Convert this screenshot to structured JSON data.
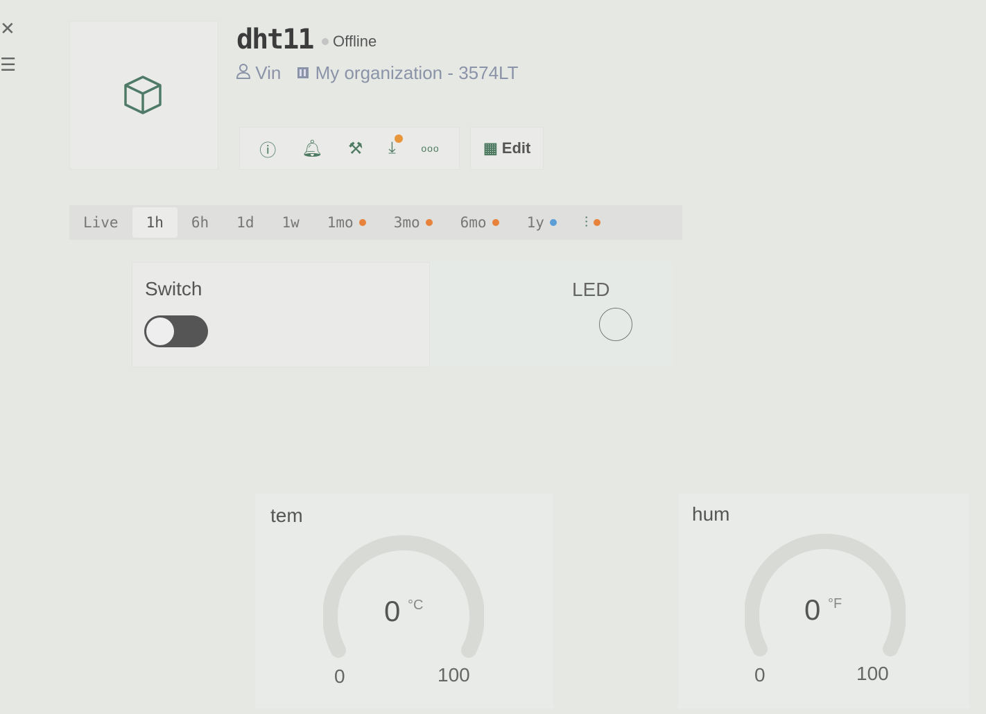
{
  "sidebar": {
    "close_icon": "close-icon",
    "menu_icon": "hamburger-menu-icon"
  },
  "device": {
    "name": "dht11",
    "status": "Offline",
    "status_color": "#c4c4c4",
    "owner": "Vin",
    "organization": "My organization - 3574LT",
    "icon": "cube-icon"
  },
  "toolbar": {
    "icons": [
      "info-icon",
      "bell-icon",
      "tools-icon",
      "download-icon",
      "more-icon"
    ],
    "edit_label": "Edit",
    "badge_color": "#e8963c"
  },
  "time_tabs": [
    {
      "label": "Live",
      "dot": null
    },
    {
      "label": "1h",
      "dot": null,
      "active": true
    },
    {
      "label": "6h",
      "dot": null
    },
    {
      "label": "1d",
      "dot": null
    },
    {
      "label": "1w",
      "dot": null
    },
    {
      "label": "1mo",
      "dot": "#e8823a"
    },
    {
      "label": "3mo",
      "dot": "#e8823a"
    },
    {
      "label": "6mo",
      "dot": "#e8823a"
    },
    {
      "label": "1y",
      "dot": "#5b9fd6"
    },
    {
      "label": "",
      "icon": "sliders-icon",
      "dot": "#e8823a"
    }
  ],
  "widgets": {
    "switch": {
      "label": "Switch",
      "state": "off"
    },
    "led": {
      "label": "LED",
      "state": "off"
    },
    "tem": {
      "label": "tem",
      "value": "0",
      "unit": "°C",
      "min": "0",
      "max": "100"
    },
    "hum": {
      "label": "hum",
      "value": "0",
      "unit": "°F",
      "min": "0",
      "max": "100"
    }
  }
}
